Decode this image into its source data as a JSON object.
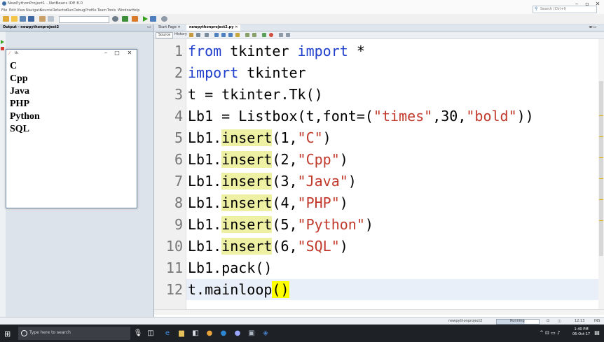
{
  "window": {
    "title": "NewPythonProject1 - NetBeans IDE 8.0"
  },
  "menubar": [
    "File",
    "Edit",
    "View",
    "Navigate",
    "Source",
    "Refactor",
    "Run",
    "Debug",
    "Profile",
    "Team",
    "Tools",
    "Window",
    "Help"
  ],
  "search": {
    "placeholder": "Search (Ctrl+I)"
  },
  "output_panel": {
    "tab_label": "Output - newpythonproject2"
  },
  "tk_window": {
    "title": "tk",
    "listbox_items": [
      "C",
      "Cpp",
      "Java",
      "PHP",
      "Python",
      "SQL"
    ]
  },
  "editor": {
    "tabs": [
      {
        "label": "Start Page",
        "active": false
      },
      {
        "label": "newpythonproject2.py",
        "active": true
      }
    ],
    "view_tabs": [
      "Source",
      "History"
    ],
    "line_numbers": [
      "1",
      "2",
      "3",
      "4",
      "5",
      "6",
      "7",
      "8",
      "9",
      "10",
      "11",
      "12"
    ]
  },
  "status": {
    "project": "newpythonproject2",
    "task": "Running",
    "position": "12:13",
    "mode": "INS"
  },
  "taskbar": {
    "search_placeholder": "Type here to search",
    "time": "1:40 PM",
    "date": "06-Oct-17"
  },
  "colors": {
    "keyword": "#1f3fcc",
    "string": "#c0392b",
    "highlight": "#eef0a3",
    "brace_match": "#ffff00"
  }
}
